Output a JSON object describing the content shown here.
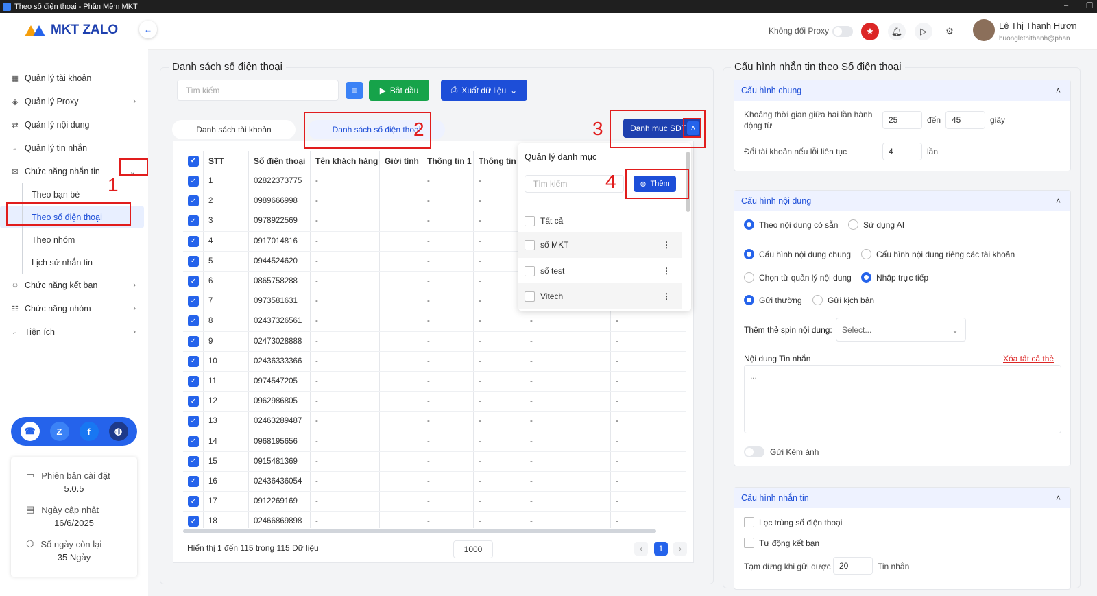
{
  "window": {
    "title": "Theo số điện thoại - Phần Mềm MKT"
  },
  "brand": {
    "name": "MKT ZALO",
    "accent": "#2563eb",
    "highlight": "#e11d1d"
  },
  "sidebar": {
    "items": [
      {
        "label": "Quản lý tài khoản",
        "icon": "grid-icon"
      },
      {
        "label": "Quản lý Proxy",
        "icon": "layers-icon"
      },
      {
        "label": "Quản lý nội dung",
        "icon": "shuffle-icon"
      },
      {
        "label": "Quản lý tin nhắn",
        "icon": "search-icon"
      },
      {
        "label": "Chức năng nhắn tin",
        "icon": "chat-icon"
      }
    ],
    "sub_items": [
      "Theo bạn bè",
      "Theo số điện thoại",
      "Theo nhóm",
      "Lịch sử nhắn tin"
    ],
    "items2": [
      {
        "label": "Chức năng kết bạn",
        "icon": "user-add-icon"
      },
      {
        "label": "Chức năng nhóm",
        "icon": "group-icon"
      },
      {
        "label": "Tiện ích",
        "icon": "search-icon"
      }
    ]
  },
  "info": {
    "version_label": "Phiên bản cài đặt",
    "version": "5.0.5",
    "update_label": "Ngày cập nhật",
    "update_date": "16/6/2025",
    "days_label": "Số ngày còn lại",
    "days": "35 Ngày"
  },
  "header": {
    "proxy_label": "Không đổi Proxy",
    "user_name": "Lê Thị Thanh Hươn",
    "user_email": "huonglethithanh@phan"
  },
  "main": {
    "title": "Danh sách số điện thoại",
    "search_placeholder": "Tìm kiếm",
    "start_label": "Bắt đầu",
    "export_label": "Xuất dữ liệu",
    "tabs": [
      "Danh sách tài khoản",
      "Danh sách số điện thoại"
    ],
    "category_button": "Danh mục SDT",
    "columns": [
      "STT",
      "Số điện thoại",
      "Tên khách hàng",
      "Giới tính",
      "Thông tin 1",
      "Thông tin 2"
    ],
    "rows": [
      [
        "1",
        "02822373775"
      ],
      [
        "2",
        "0989666998"
      ],
      [
        "3",
        "0978922569"
      ],
      [
        "4",
        "0917014816"
      ],
      [
        "5",
        "0944524620"
      ],
      [
        "6",
        "0865758288"
      ],
      [
        "7",
        "0973581631"
      ],
      [
        "8",
        "02437326561"
      ],
      [
        "9",
        "02473028888"
      ],
      [
        "10",
        "02436333366"
      ],
      [
        "11",
        "0974547205"
      ],
      [
        "12",
        "0962986805"
      ],
      [
        "13",
        "02463289487"
      ],
      [
        "14",
        "0968195656"
      ],
      [
        "15",
        "0915481369"
      ],
      [
        "16",
        "02436436054"
      ],
      [
        "17",
        "0912269169"
      ],
      [
        "18",
        "02466869898"
      ]
    ],
    "empty": "-",
    "footer_text": "Hiển thị 1 đến 115 trong 115 Dữ liệu",
    "page_size": "1000",
    "page": "1"
  },
  "dropdown": {
    "title": "Quản lý danh mục",
    "search_placeholder": "Tìm kiếm",
    "add_label": "Thêm",
    "items": [
      "Tất cả",
      "số MKT",
      "số test",
      "Vitech"
    ]
  },
  "annotations": [
    "1",
    "2",
    "3",
    "4"
  ],
  "right": {
    "title": "Cấu hình nhắn tin theo Số điện thoại",
    "general": {
      "title": "Cấu hình chung",
      "interval_label": "Khoảng thời gian giữa hai lần hành động từ",
      "from": "25",
      "to_label": "đến",
      "to": "45",
      "unit": "giây",
      "switch_label": "Đổi tài khoản nếu lỗi liên tục",
      "switch_value": "4",
      "switch_unit": "lần"
    },
    "content": {
      "title": "Cấu hình nội dung",
      "r1": [
        "Theo nội dung có sẵn",
        "Sử dụng AI"
      ],
      "r2": [
        "Cấu hình nội dung chung",
        "Cấu hình nội dung riêng các tài khoản"
      ],
      "r3": [
        "Chọn từ quản lý nội dung",
        "Nhập trực tiếp"
      ],
      "r4": [
        "Gửi thường",
        "Gửi kịch bản"
      ],
      "spin_label": "Thêm thẻ spin nội dung:",
      "spin_placeholder": "Select...",
      "msg_label": "Nội dung Tin nhắn",
      "clear_label": "Xóa tất cả thẻ",
      "msg_value": "...",
      "attach_label": "Gửi Kèm ảnh"
    },
    "message": {
      "title": "Cấu hình nhắn tin",
      "dedupe_label": "Lọc trùng số điện thoại",
      "autofriend_label": "Tự động kết bạn",
      "pause_label": "Tạm dừng khi gửi được",
      "pause_value": "20",
      "pause_unit": "Tin nhắn"
    }
  }
}
